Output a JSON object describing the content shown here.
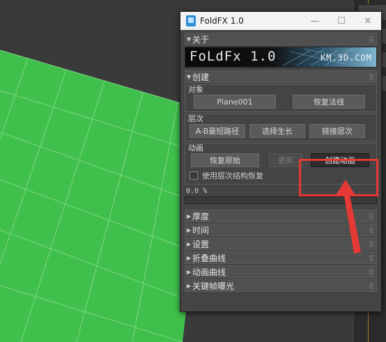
{
  "window": {
    "title": "FoldFX 1.0",
    "minimize": "—",
    "maximize": "☐",
    "close": "✕"
  },
  "rollouts": {
    "about": {
      "label": "关于",
      "banner_title": "FoLdFx 1.0",
      "banner_site": "KM.3D.COM"
    },
    "create": {
      "label": "创建",
      "object": {
        "label": "对象",
        "plane_button": "Plane001",
        "restore_normals": "恢复法线"
      },
      "hierarchy": {
        "label": "层次",
        "shortest_path": "A-B最短路径",
        "select_growth": "选择生长",
        "link_hierarchy": "链接层次"
      },
      "animation": {
        "label": "动画",
        "restore_original": "恢复原始",
        "update": "更新",
        "create_animation": "创建动画",
        "use_hierarchy_restore": "使用层次结构恢复",
        "use_hierarchy_restore_checked": false
      },
      "progress_text": "0.0 %",
      "progress_value": 0.0
    },
    "collapsed": [
      "厚度",
      "时间",
      "设置",
      "折叠曲线",
      "动画曲线",
      "关键帧曝光"
    ]
  },
  "colors": {
    "viewport_green": "#3fbf4c",
    "highlight": "#e53935"
  }
}
